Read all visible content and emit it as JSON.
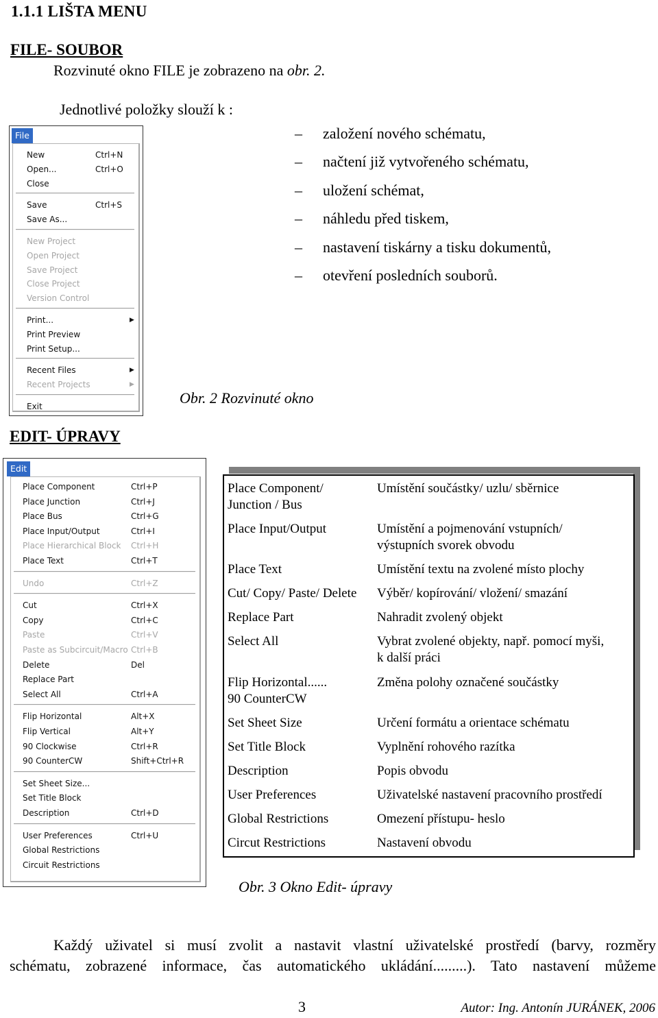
{
  "heading": "1.1.1 LIŠTA MENU",
  "file_section": {
    "title": "FILE- SOUBOR",
    "intro_prefix": "Rozvinuté okno FILE je zobrazeno na ",
    "intro_ref": "obr. 2.",
    "list_intro": "Jednotlivé položky slouží k :",
    "bullet_dash": "–",
    "bullets": [
      "založení nového schématu,",
      "načtení již vytvořeného schématu,",
      "uložení schémat,",
      "náhledu před tiskem,",
      "nastavení tiskárny a tisku dokumentů,",
      "otevření posledních souborů."
    ],
    "figure_caption": "Obr. 2 Rozvinuté okno",
    "menu": {
      "title": "File",
      "items": [
        {
          "label": "New",
          "shortcut": "Ctrl+N",
          "enabled": true
        },
        {
          "label": "Open...",
          "shortcut": "Ctrl+O",
          "enabled": true
        },
        {
          "label": "Close",
          "shortcut": "",
          "enabled": true
        },
        {
          "label": "Save",
          "shortcut": "Ctrl+S",
          "enabled": true
        },
        {
          "label": "Save As...",
          "shortcut": "",
          "enabled": true
        },
        {
          "label": "New Project",
          "shortcut": "",
          "enabled": false
        },
        {
          "label": "Open Project",
          "shortcut": "",
          "enabled": false
        },
        {
          "label": "Save Project",
          "shortcut": "",
          "enabled": false
        },
        {
          "label": "Close Project",
          "shortcut": "",
          "enabled": false
        },
        {
          "label": "Version Control",
          "shortcut": "",
          "enabled": false
        },
        {
          "label": "Print...",
          "shortcut": "",
          "enabled": true,
          "submenu": true
        },
        {
          "label": "Print Preview",
          "shortcut": "",
          "enabled": true
        },
        {
          "label": "Print Setup...",
          "shortcut": "",
          "enabled": true
        },
        {
          "label": "Recent Files",
          "shortcut": "",
          "enabled": true,
          "submenu": true
        },
        {
          "label": "Recent Projects",
          "shortcut": "",
          "enabled": false,
          "submenu": true
        },
        {
          "label": "Exit",
          "shortcut": "",
          "enabled": true
        }
      ]
    }
  },
  "edit_section": {
    "title": "EDIT- ÚPRAVY",
    "figure_caption": "Obr. 3  Okno Edit- úpravy",
    "menu": {
      "title": "Edit",
      "items": [
        {
          "label": "Place Component",
          "shortcut": "Ctrl+P",
          "enabled": true
        },
        {
          "label": "Place Junction",
          "shortcut": "Ctrl+J",
          "enabled": true
        },
        {
          "label": "Place Bus",
          "shortcut": "Ctrl+G",
          "enabled": true
        },
        {
          "label": "Place Input/Output",
          "shortcut": "Ctrl+I",
          "enabled": true
        },
        {
          "label": "Place Hierarchical Block",
          "shortcut": "Ctrl+H",
          "enabled": false
        },
        {
          "label": "Place Text",
          "shortcut": "Ctrl+T",
          "enabled": true
        },
        {
          "label": "Undo",
          "shortcut": "Ctrl+Z",
          "enabled": false
        },
        {
          "label": "Cut",
          "shortcut": "Ctrl+X",
          "enabled": true
        },
        {
          "label": "Copy",
          "shortcut": "Ctrl+C",
          "enabled": true
        },
        {
          "label": "Paste",
          "shortcut": "Ctrl+V",
          "enabled": false
        },
        {
          "label": "Paste as Subcircuit/Macro",
          "shortcut": "Ctrl+B",
          "enabled": false
        },
        {
          "label": "Delete",
          "shortcut": "Del",
          "enabled": true
        },
        {
          "label": "Replace Part",
          "shortcut": "",
          "enabled": true
        },
        {
          "label": "Select All",
          "shortcut": "Ctrl+A",
          "enabled": true
        },
        {
          "label": "Flip Horizontal",
          "shortcut": "Alt+X",
          "enabled": true
        },
        {
          "label": "Flip Vertical",
          "shortcut": "Alt+Y",
          "enabled": true
        },
        {
          "label": "90 Clockwise",
          "shortcut": "Ctrl+R",
          "enabled": true
        },
        {
          "label": "90 CounterCW",
          "shortcut": "Shift+Ctrl+R",
          "enabled": true
        },
        {
          "label": "Set Sheet Size...",
          "shortcut": "",
          "enabled": true
        },
        {
          "label": "Set Title Block",
          "shortcut": "",
          "enabled": true
        },
        {
          "label": "Description",
          "shortcut": "Ctrl+D",
          "enabled": true
        },
        {
          "label": "User Preferences",
          "shortcut": "Ctrl+U",
          "enabled": true
        },
        {
          "label": "Global Restrictions",
          "shortcut": "",
          "enabled": true
        },
        {
          "label": "Circuit Restrictions",
          "shortcut": "",
          "enabled": true
        }
      ]
    },
    "table": [
      {
        "command": "Place Component/\nJunction / Bus",
        "description": "Umístění součástky/ uzlu/ sběrnice"
      },
      {
        "command": "Place Input/Output",
        "description": "Umístění a pojmenování vstupních/\nvýstupních svorek obvodu"
      },
      {
        "command": "Place Text",
        "description": "Umístění textu na zvolené místo plochy"
      },
      {
        "command": "Cut/ Copy/ Paste/ Delete",
        "description": "Výběr/ kopírování/ vložení/ smazání"
      },
      {
        "command": "Replace Part",
        "description": "Nahradit zvolený objekt"
      },
      {
        "command": "Select All",
        "description": "Vybrat zvolené objekty, např. pomocí myši,\nk další práci"
      },
      {
        "command": "Flip Horizontal......\n90 CounterCW",
        "description": "Změna polohy označené součástky"
      },
      {
        "command": "Set Sheet Size",
        "description": "Určení formátu a orientace schématu"
      },
      {
        "command": "Set Title Block",
        "description": "Vyplnění rohového razítka"
      },
      {
        "command": "Description",
        "description": "Popis obvodu"
      },
      {
        "command": "User Preferences",
        "description": "Uživatelské nastavení pracovního prostředí"
      },
      {
        "command": "Global Restrictions",
        "description": "Omezení přístupu- heslo"
      },
      {
        "command": "Circut Restrictions",
        "description": "Nastavení obvodu"
      }
    ]
  },
  "closing_paragraph": {
    "line1": "Každý uživatel si musí zvolit a nastavit vlastní uživatelské prostředí (barvy, rozměry",
    "line2": "schématu, zobrazené informace, čas automatického ukládání.........). Tato nastavení můžeme"
  },
  "footer": {
    "page_number": "3",
    "author": "Autor: Ing. Antonín JURÁNEK, 2006"
  },
  "colors": {
    "menu_highlight": "#316ac5",
    "disabled_text": "#a6a6a6",
    "table_shadow": "#808080"
  }
}
